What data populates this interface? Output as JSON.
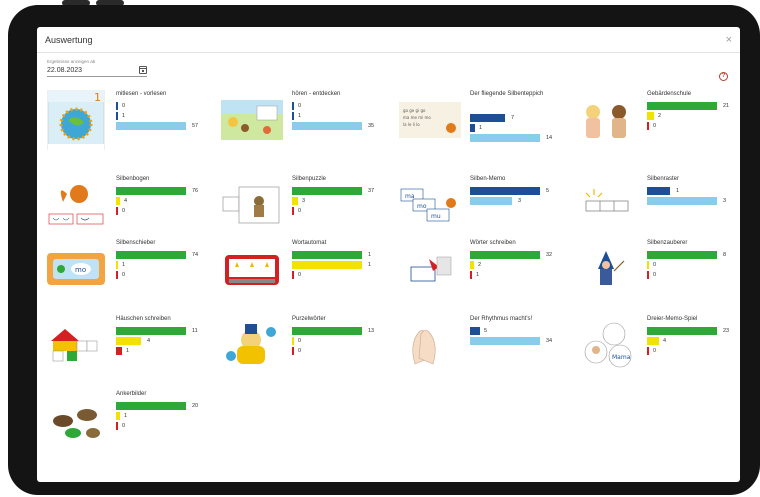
{
  "window": {
    "title": "Auswertung",
    "close_icon": "×"
  },
  "date_filter": {
    "label": "Ergebnisse anzeigen ab",
    "value": "22.08.2023"
  },
  "help_icon": "?",
  "colors": {
    "green": "#2ea836",
    "yellow": "#f2e200",
    "red": "#d42020",
    "blue": "#1c4f95",
    "light_blue": "#89cdea"
  },
  "exercises": [
    {
      "title": "mitlesen - vorlesen",
      "bars": [
        {
          "color": "blue",
          "value": 0
        },
        {
          "color": "blue",
          "value": 1
        },
        {
          "color": "light",
          "value": 57
        }
      ]
    },
    {
      "title": "hören - entdecken",
      "bars": [
        {
          "color": "blue",
          "value": 0
        },
        {
          "color": "blue",
          "value": 1
        },
        {
          "color": "light",
          "value": 35
        }
      ]
    },
    {
      "title": "Der fliegende Silbenteppich",
      "bars": [
        {
          "color": "blue",
          "value": 7
        },
        {
          "color": "blue",
          "value": 1
        },
        {
          "color": "light",
          "value": 14
        }
      ]
    },
    {
      "title": "Gebärdenschule",
      "bars": [
        {
          "color": "green",
          "value": 21
        },
        {
          "color": "yellow",
          "value": 2
        },
        {
          "color": "red",
          "value": 0
        }
      ]
    },
    {
      "title": "Silbenbogen",
      "bars": [
        {
          "color": "green",
          "value": 76
        },
        {
          "color": "yellow",
          "value": 4
        },
        {
          "color": "red",
          "value": 0
        }
      ]
    },
    {
      "title": "Silbenpuzzle",
      "bars": [
        {
          "color": "green",
          "value": 37
        },
        {
          "color": "yellow",
          "value": 3
        },
        {
          "color": "red",
          "value": 0
        }
      ]
    },
    {
      "title": "Silben-Memo",
      "bars": [
        {
          "color": "blue",
          "value": 5
        },
        {
          "color": "light",
          "value": 3
        }
      ]
    },
    {
      "title": "Silbenraster",
      "bars": [
        {
          "color": "blue",
          "value": 1
        },
        {
          "color": "light",
          "value": 3
        }
      ]
    },
    {
      "title": "Silbenschieber",
      "bars": [
        {
          "color": "green",
          "value": 74
        },
        {
          "color": "yellow",
          "value": 1
        },
        {
          "color": "red",
          "value": 0
        }
      ]
    },
    {
      "title": "Wortautomat",
      "bars": [
        {
          "color": "green",
          "value": 1
        },
        {
          "color": "yellow",
          "value": 1
        },
        {
          "color": "red",
          "value": 0
        }
      ]
    },
    {
      "title": "Wörter schreiben",
      "bars": [
        {
          "color": "green",
          "value": 32
        },
        {
          "color": "yellow",
          "value": 2
        },
        {
          "color": "red",
          "value": 1
        }
      ]
    },
    {
      "title": "Silbenzauberer",
      "bars": [
        {
          "color": "green",
          "value": 8
        },
        {
          "color": "yellow",
          "value": 0
        },
        {
          "color": "red",
          "value": 0
        }
      ]
    },
    {
      "title": "Häuschen schreiben",
      "bars": [
        {
          "color": "green",
          "value": 11
        },
        {
          "color": "yellow",
          "value": 4
        },
        {
          "color": "red",
          "value": 1
        }
      ]
    },
    {
      "title": "Purzelwörter",
      "bars": [
        {
          "color": "green",
          "value": 13
        },
        {
          "color": "yellow",
          "value": 0
        },
        {
          "color": "red",
          "value": 0
        }
      ]
    },
    {
      "title": "Der Rhythmus macht's!",
      "bars": [
        {
          "color": "blue",
          "value": 5
        },
        {
          "color": "light",
          "value": 34
        }
      ]
    },
    {
      "title": "Dreier-Memo-Spiel",
      "bars": [
        {
          "color": "green",
          "value": 23
        },
        {
          "color": "yellow",
          "value": 4
        },
        {
          "color": "red",
          "value": 0
        }
      ]
    },
    {
      "title": "Ankerbilder",
      "bars": [
        {
          "color": "green",
          "value": 20
        },
        {
          "color": "yellow",
          "value": 1
        },
        {
          "color": "red",
          "value": 0
        }
      ]
    }
  ]
}
